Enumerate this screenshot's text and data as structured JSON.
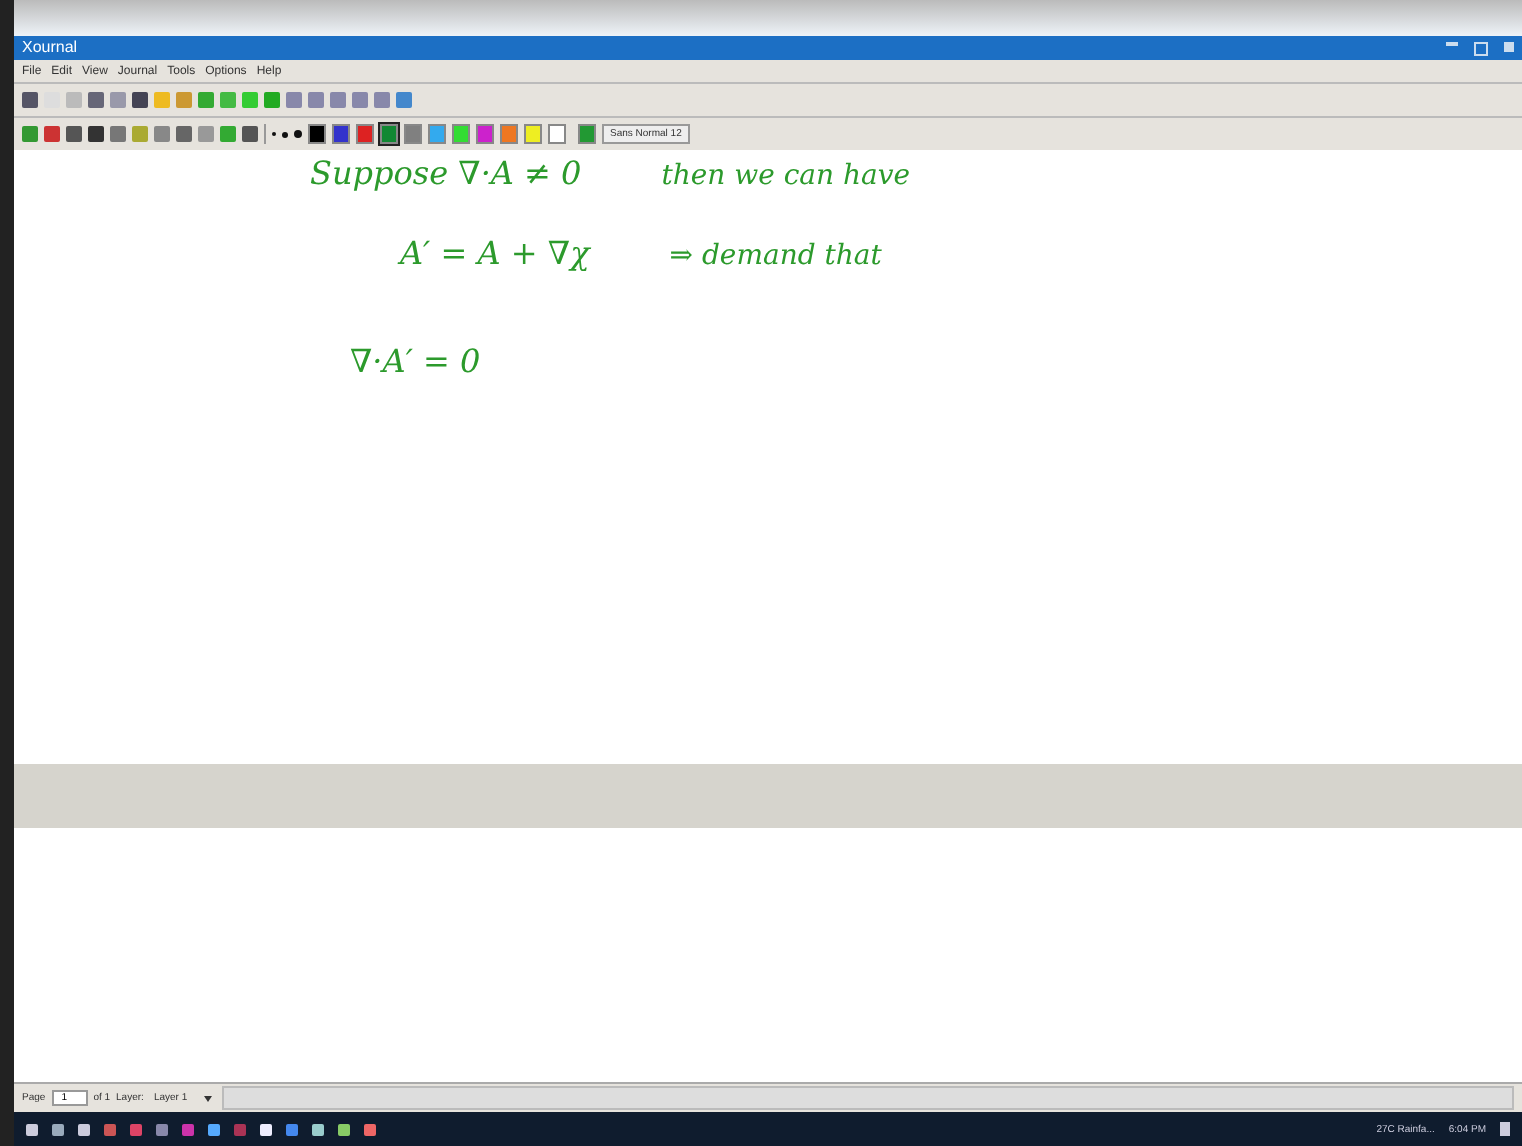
{
  "window": {
    "title": "Xournal"
  },
  "menu": [
    "File",
    "Edit",
    "View",
    "Journal",
    "Tools",
    "Options",
    "Help"
  ],
  "pen_colors": [
    {
      "color": "#000000",
      "selected": false
    },
    {
      "color": "#3333cc",
      "selected": false
    },
    {
      "color": "#dd2222",
      "selected": false
    },
    {
      "color": "#118833",
      "selected": true
    },
    {
      "color": "#808080",
      "selected": false
    },
    {
      "color": "#33aaee",
      "selected": false
    },
    {
      "color": "#33dd33",
      "selected": false
    },
    {
      "color": "#cc22cc",
      "selected": false
    },
    {
      "color": "#ee7722",
      "selected": false
    },
    {
      "color": "#eeee22",
      "selected": false
    },
    {
      "color": "#ffffff",
      "selected": false
    }
  ],
  "current_color": {
    "color": "#229933"
  },
  "font_button": "Sans Normal 12",
  "ink_lines": [
    {
      "parts": [
        "Suppose  ∇·A ≠ 0",
        "then we can have"
      ]
    },
    {
      "parts": [
        "A′ = A + ∇χ",
        "⇒ demand that"
      ]
    },
    {
      "parts": [
        "∇·A′ = 0"
      ]
    }
  ],
  "status_bar": {
    "page_label": "Page",
    "page_value": "1",
    "page_count": "of 1",
    "layer_label": "Layer:",
    "layer_value": "Layer 1"
  },
  "taskbar": {
    "tray_text": "27C Rainfa...",
    "time": "6:04 PM"
  }
}
